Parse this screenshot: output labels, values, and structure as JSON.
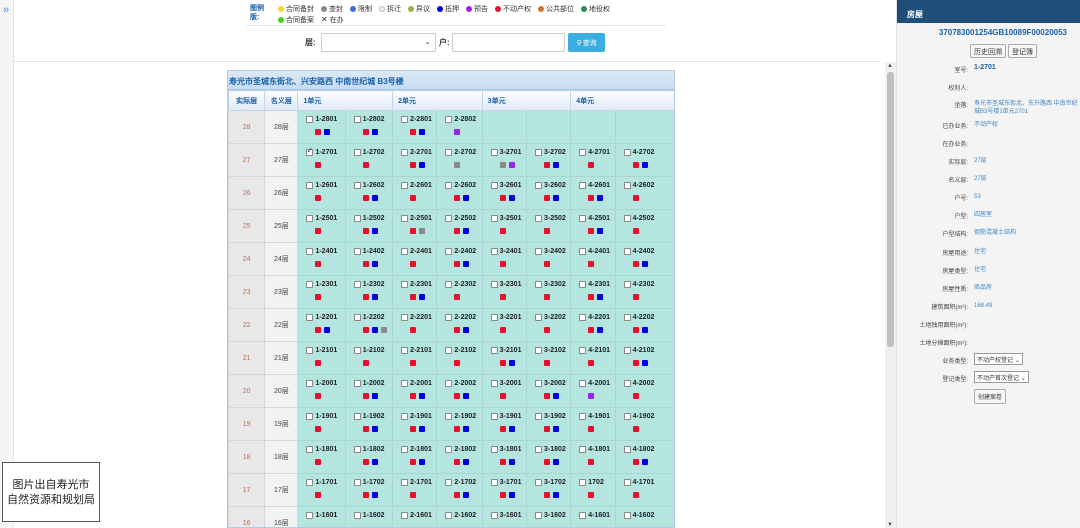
{
  "legend": {
    "title": "图例版:",
    "row1": [
      {
        "label": "合同备封",
        "color": "#f2d531",
        "shape": "dot"
      },
      {
        "label": "查封",
        "color": "#8a8a8a",
        "shape": "dot"
      },
      {
        "label": "限制",
        "color": "#4169e1",
        "shape": "dot"
      },
      {
        "label": "拆迁",
        "color": "#eeeeee",
        "shape": "dot"
      },
      {
        "label": "异议",
        "color": "#a8a84a",
        "shape": "dot"
      },
      {
        "label": "抵押",
        "color": "#0000e0",
        "shape": "dot"
      },
      {
        "label": "预告",
        "color": "#9a22ee",
        "shape": "dot"
      },
      {
        "label": "不动产权",
        "color": "#e8112d",
        "shape": "dot"
      },
      {
        "label": "公共部位",
        "color": "#c9732e",
        "shape": "dot"
      },
      {
        "label": "地役权",
        "color": "#2e8b57",
        "shape": "dot"
      }
    ],
    "row2": [
      {
        "label": "合同备案",
        "color": "#47d11e",
        "shape": "dot"
      },
      {
        "label": "在办",
        "color": "#333333",
        "shape": "cross"
      }
    ]
  },
  "search": {
    "floor_label": "层:",
    "unit_label": "户:",
    "query_button": "查询",
    "search_icon": "search-icon"
  },
  "building": {
    "title": "寿光市圣城东街北、兴安路西 中南世纪城 B3号楼",
    "headers": {
      "actual_floor": "实际层",
      "nominal_floor": "名义层",
      "units": [
        "1单元",
        "2单元",
        "3单元",
        "4单元"
      ]
    },
    "rows": [
      {
        "actual": "28",
        "nominal": "28层",
        "cells": [
          {
            "room": "1-2801",
            "marks": [
              "red",
              "blue"
            ]
          },
          {
            "room": "1-2802",
            "marks": [
              "red",
              "blue"
            ]
          },
          {
            "room": "2-2801",
            "marks": [
              "red",
              "blue"
            ]
          },
          {
            "room": "2-2802",
            "marks": [
              "purple"
            ]
          },
          null,
          null,
          null,
          null
        ]
      },
      {
        "actual": "27",
        "nominal": "27层",
        "cells": [
          {
            "room": "1-2701",
            "marks": [
              "red"
            ],
            "checked": true
          },
          {
            "room": "1-2702",
            "marks": [
              "red"
            ]
          },
          {
            "room": "2-2701",
            "marks": [
              "red",
              "blue"
            ]
          },
          {
            "room": "2-2702",
            "marks": [
              "gray"
            ]
          },
          {
            "room": "3-2701",
            "marks": [
              "gray",
              "purple"
            ]
          },
          {
            "room": "3-2702",
            "marks": [
              "red",
              "blue"
            ]
          },
          {
            "room": "4-2701",
            "marks": [
              "red"
            ]
          },
          {
            "room": "4-2702",
            "marks": [
              "red",
              "blue"
            ]
          }
        ]
      },
      {
        "actual": "26",
        "nominal": "26层",
        "cells": [
          {
            "room": "1-2601",
            "marks": [
              "red"
            ]
          },
          {
            "room": "1-2602",
            "marks": [
              "red",
              "blue"
            ]
          },
          {
            "room": "2-2601",
            "marks": [
              "red"
            ]
          },
          {
            "room": "2-2602",
            "marks": [
              "red",
              "blue"
            ]
          },
          {
            "room": "3-2601",
            "marks": [
              "red",
              "blue"
            ]
          },
          {
            "room": "3-2602",
            "marks": [
              "red",
              "blue"
            ]
          },
          {
            "room": "4-2601",
            "marks": [
              "red",
              "blue"
            ]
          },
          {
            "room": "4-2602",
            "marks": [
              "red"
            ]
          }
        ]
      },
      {
        "actual": "25",
        "nominal": "25层",
        "cells": [
          {
            "room": "1-2501",
            "marks": [
              "red"
            ]
          },
          {
            "room": "1-2502",
            "marks": [
              "red",
              "blue"
            ]
          },
          {
            "room": "2-2501",
            "marks": [
              "red",
              "gray"
            ]
          },
          {
            "room": "2-2502",
            "marks": [
              "red",
              "blue"
            ]
          },
          {
            "room": "3-2501",
            "marks": [
              "red"
            ]
          },
          {
            "room": "3-2502",
            "marks": [
              "red"
            ]
          },
          {
            "room": "4-2501",
            "marks": [
              "red",
              "blue"
            ]
          },
          {
            "room": "4-2502",
            "marks": [
              "red"
            ]
          }
        ]
      },
      {
        "actual": "24",
        "nominal": "24层",
        "cells": [
          {
            "room": "1-2401",
            "marks": [
              "red"
            ]
          },
          {
            "room": "1-2402",
            "marks": [
              "red",
              "blue"
            ]
          },
          {
            "room": "2-2401",
            "marks": [
              "red"
            ]
          },
          {
            "room": "2-2402",
            "marks": [
              "red",
              "blue"
            ]
          },
          {
            "room": "3-2401",
            "marks": [
              "red"
            ]
          },
          {
            "room": "3-2402",
            "marks": [
              "red"
            ]
          },
          {
            "room": "4-2401",
            "marks": [
              "red"
            ]
          },
          {
            "room": "4-2402",
            "marks": [
              "red",
              "blue"
            ]
          }
        ]
      },
      {
        "actual": "23",
        "nominal": "23层",
        "cells": [
          {
            "room": "1-2301",
            "marks": [
              "red"
            ]
          },
          {
            "room": "1-2302",
            "marks": [
              "red",
              "blue"
            ]
          },
          {
            "room": "2-2301",
            "marks": [
              "red",
              "blue"
            ]
          },
          {
            "room": "2-2302",
            "marks": [
              "red"
            ]
          },
          {
            "room": "3-2301",
            "marks": [
              "red"
            ]
          },
          {
            "room": "3-2302",
            "marks": [
              "red"
            ]
          },
          {
            "room": "4-2301",
            "marks": [
              "red",
              "blue"
            ]
          },
          {
            "room": "4-2302",
            "marks": [
              "red"
            ]
          }
        ]
      },
      {
        "actual": "22",
        "nominal": "22层",
        "cells": [
          {
            "room": "1-2201",
            "marks": [
              "red",
              "blue"
            ]
          },
          {
            "room": "1-2202",
            "marks": [
              "red",
              "blue",
              "gray"
            ]
          },
          {
            "room": "2-2201",
            "marks": [
              "red"
            ]
          },
          {
            "room": "2-2202",
            "marks": [
              "red",
              "blue"
            ]
          },
          {
            "room": "3-2201",
            "marks": [
              "red"
            ]
          },
          {
            "room": "3-2202",
            "marks": [
              "red"
            ]
          },
          {
            "room": "4-2201",
            "marks": [
              "red",
              "blue"
            ]
          },
          {
            "room": "4-2202",
            "marks": [
              "red",
              "blue"
            ]
          }
        ]
      },
      {
        "actual": "21",
        "nominal": "21层",
        "cells": [
          {
            "room": "1-2101",
            "marks": [
              "red"
            ]
          },
          {
            "room": "1-2102",
            "marks": [
              "red"
            ]
          },
          {
            "room": "2-2101",
            "marks": [
              "red"
            ]
          },
          {
            "room": "2-2102",
            "marks": [
              "red"
            ]
          },
          {
            "room": "3-2101",
            "marks": [
              "red",
              "blue"
            ]
          },
          {
            "room": "3-2102",
            "marks": [
              "red"
            ]
          },
          {
            "room": "4-2101",
            "marks": [
              "red"
            ]
          },
          {
            "room": "4-2102",
            "marks": [
              "red",
              "blue"
            ]
          }
        ]
      },
      {
        "actual": "20",
        "nominal": "20层",
        "cells": [
          {
            "room": "1-2001",
            "marks": [
              "red"
            ]
          },
          {
            "room": "1-2002",
            "marks": [
              "red",
              "blue"
            ]
          },
          {
            "room": "2-2001",
            "marks": [
              "red",
              "blue"
            ]
          },
          {
            "room": "2-2002",
            "marks": [
              "red",
              "blue"
            ]
          },
          {
            "room": "3-2001",
            "marks": [
              "red"
            ]
          },
          {
            "room": "3-2002",
            "marks": [
              "red",
              "blue"
            ]
          },
          {
            "room": "4-2001",
            "marks": [
              "purple"
            ]
          },
          {
            "room": "4-2002",
            "marks": [
              "red"
            ]
          }
        ]
      },
      {
        "actual": "19",
        "nominal": "19层",
        "cells": [
          {
            "room": "1-1901",
            "marks": [
              "red"
            ]
          },
          {
            "room": "1-1902",
            "marks": [
              "red",
              "blue"
            ]
          },
          {
            "room": "2-1901",
            "marks": [
              "red",
              "blue"
            ]
          },
          {
            "room": "2-1902",
            "marks": [
              "red",
              "blue"
            ]
          },
          {
            "room": "3-1901",
            "marks": [
              "red",
              "blue"
            ]
          },
          {
            "room": "3-1902",
            "marks": [
              "red",
              "blue"
            ]
          },
          {
            "room": "4-1901",
            "marks": [
              "red"
            ]
          },
          {
            "room": "4-1902",
            "marks": [
              "red"
            ]
          }
        ]
      },
      {
        "actual": "18",
        "nominal": "18层",
        "cells": [
          {
            "room": "1-1801",
            "marks": [
              "red"
            ]
          },
          {
            "room": "1-1802",
            "marks": [
              "red",
              "blue"
            ]
          },
          {
            "room": "2-1801",
            "marks": [
              "red",
              "blue"
            ]
          },
          {
            "room": "2-1802",
            "marks": [
              "red",
              "blue"
            ]
          },
          {
            "room": "3-1801",
            "marks": [
              "red",
              "blue"
            ]
          },
          {
            "room": "3-1802",
            "marks": [
              "red",
              "blue"
            ]
          },
          {
            "room": "4-1801",
            "marks": [
              "red"
            ]
          },
          {
            "room": "4-1802",
            "marks": [
              "red",
              "blue"
            ]
          }
        ]
      },
      {
        "actual": "17",
        "nominal": "17层",
        "cells": [
          {
            "room": "1-1701",
            "marks": [
              "red"
            ]
          },
          {
            "room": "1-1702",
            "marks": [
              "red",
              "blue"
            ]
          },
          {
            "room": "2-1701",
            "marks": [
              "red"
            ]
          },
          {
            "room": "2-1702",
            "marks": [
              "red",
              "blue"
            ]
          },
          {
            "room": "3-1701",
            "marks": [
              "red",
              "blue"
            ]
          },
          {
            "room": "3-1702",
            "marks": [
              "red",
              "blue"
            ]
          },
          {
            "room": "1702",
            "marks": [
              "red"
            ]
          },
          {
            "room": "4-1701",
            "marks": [
              "red"
            ]
          }
        ]
      },
      {
        "actual": "16",
        "nominal": "16层",
        "cells": [
          {
            "room": "1-1601",
            "marks": []
          },
          {
            "room": "1-1602",
            "marks": []
          },
          {
            "room": "2-1601",
            "marks": []
          },
          {
            "room": "2-1602",
            "marks": []
          },
          {
            "room": "3-1601",
            "marks": []
          },
          {
            "room": "3-1602",
            "marks": []
          },
          {
            "room": "4-1601",
            "marks": []
          },
          {
            "room": "4-1602",
            "marks": []
          }
        ]
      }
    ]
  },
  "mark_colors": {
    "red": "#e8112d",
    "blue": "#0000e0",
    "purple": "#9a22ee",
    "gray": "#8a8a8a"
  },
  "sidebar": {
    "header": "房屋",
    "code": "370783001254GB10089F00020053",
    "history_button": "历史回溯",
    "register_button": "登记簿",
    "fields": [
      {
        "key": "室号:",
        "value": "1-2701",
        "bold": true
      },
      {
        "key": "权利人:",
        "value": ""
      },
      {
        "key": "坐落:",
        "value": "寿光市圣城东街北、东升路西 中南世纪城B3号楼1单元2701"
      },
      {
        "key": "已办业务:",
        "value": "不动产权"
      },
      {
        "key": "在办业务:",
        "value": ""
      },
      {
        "key": "实际层:",
        "value": "27层"
      },
      {
        "key": "名义层:",
        "value": "27层"
      },
      {
        "key": "户号:",
        "value": "53"
      },
      {
        "key": "户型:",
        "value": "四居室"
      },
      {
        "key": "户型结构:",
        "value": "钢筋混凝土结构"
      },
      {
        "key": "房屋用途:",
        "value": "住宅"
      },
      {
        "key": "房屋类型:",
        "value": "住宅"
      },
      {
        "key": "房屋性质:",
        "value": "商品房"
      },
      {
        "key": "建筑面积(m²):",
        "value": "168.49"
      },
      {
        "key": "土地独用面积(m²):",
        "value": ""
      },
      {
        "key": "土地分摊面积(m²):",
        "value": ""
      }
    ],
    "business_type_label": "业务类型:",
    "business_type_value": "不动产权登记",
    "register_type_label": "登记类型:",
    "register_type_value": "不动产首次登记",
    "create_button": "创建案卷"
  },
  "caption": {
    "line1": "图片出自寿光市",
    "line2": "自然资源和规划局"
  }
}
